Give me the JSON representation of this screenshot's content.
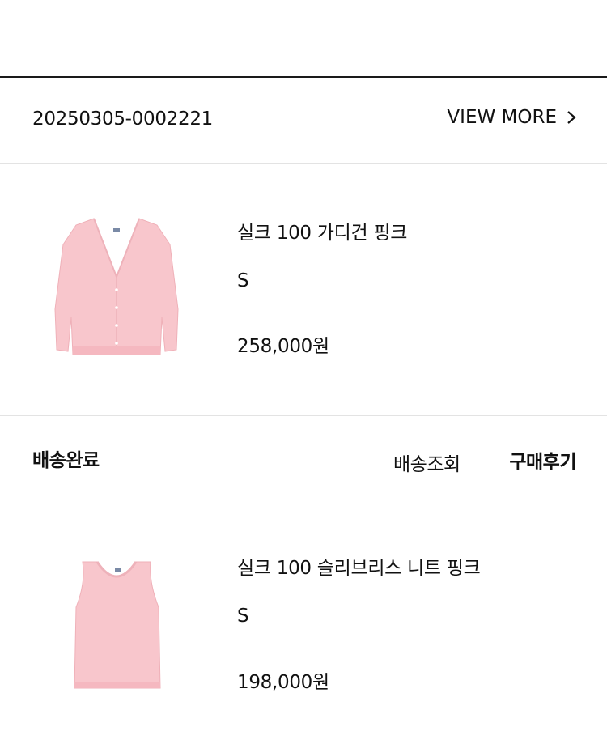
{
  "order": {
    "number": "20250305-0002221",
    "view_more_label": "VIEW MORE"
  },
  "items": [
    {
      "name": "실크 100 가디건 핑크",
      "size": "S",
      "price": "258,000원"
    },
    {
      "name": "실크 100 슬리브리스 니트 핑크",
      "size": "S",
      "price": "198,000원"
    }
  ],
  "shipping": {
    "status": "배송완료",
    "track_label": "배송조회",
    "review_label": "구매후기"
  },
  "colors": {
    "product_pink": "#f8c6cc",
    "divider": "#e3e3e3"
  }
}
